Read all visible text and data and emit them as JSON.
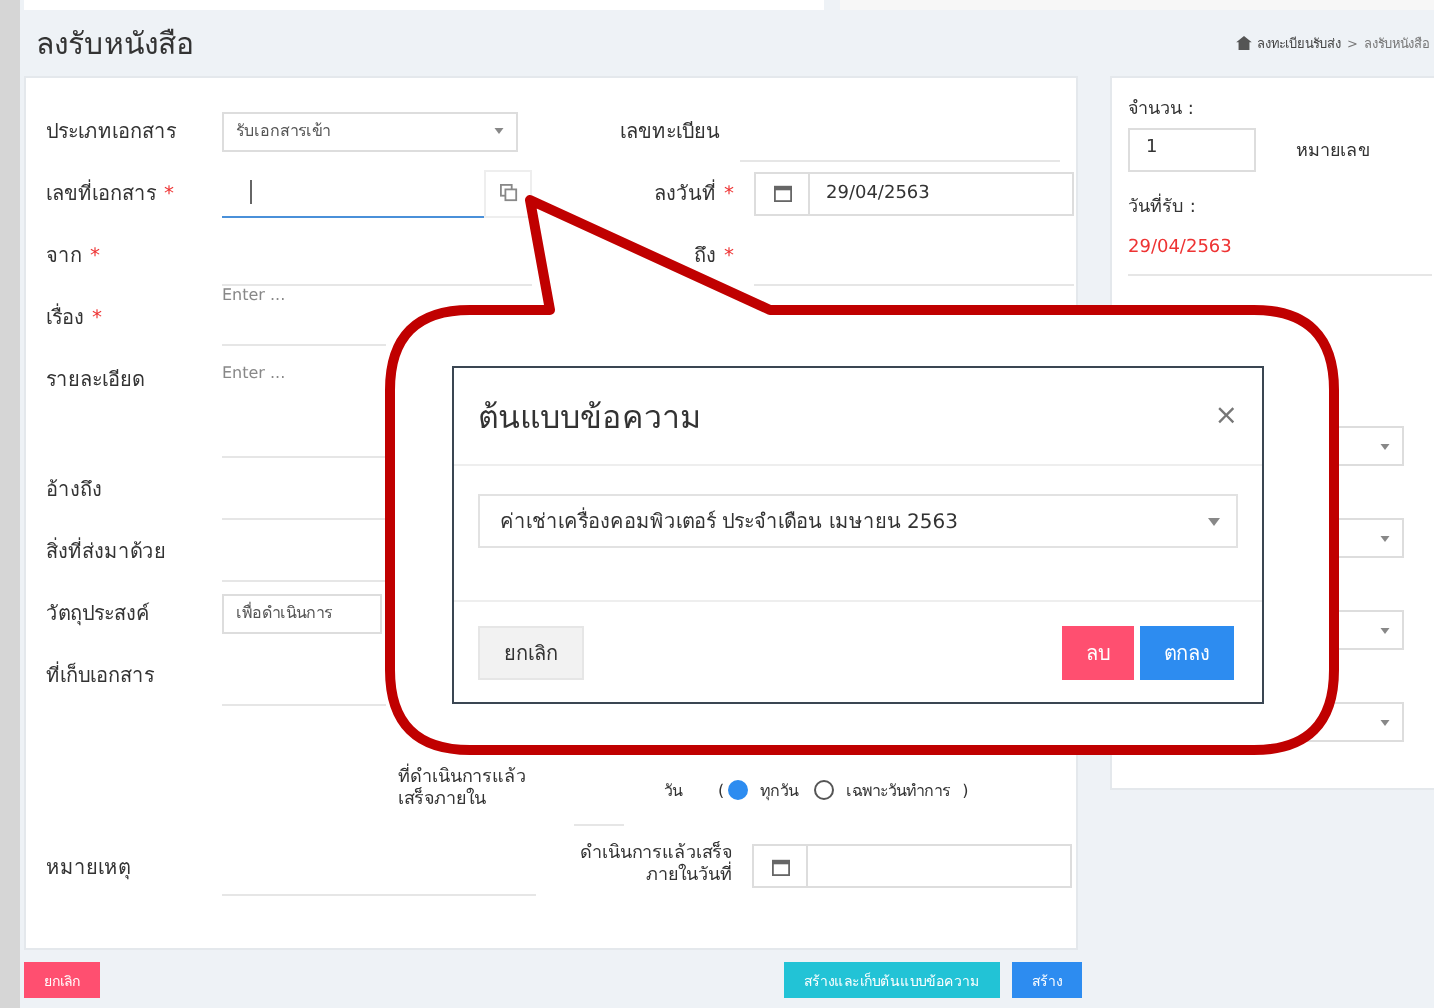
{
  "header": {
    "title": "ลงรับหนังสือ",
    "breadcrumb": [
      "ลงทะเบียนรับส่ง",
      "ลงรับหนังสือ"
    ],
    "separator": ">"
  },
  "form": {
    "top_rows": [
      {
        "left": {
          "label": "ประเภทเอกสาร",
          "kind": "select",
          "value": "รับเอกสารเข้า"
        },
        "right": {
          "label": "เลขทะเบียน",
          "kind": "line"
        }
      },
      {
        "left": {
          "label": "เลขที่เอกสาร",
          "mark": "*",
          "kind": "copy",
          "focused": true
        },
        "right": {
          "label": "ลงวันที่",
          "mark": "*",
          "kind": "date",
          "value": "29/04/2563"
        }
      },
      {
        "left": {
          "label": "จาก",
          "mark": "*",
          "kind": "line"
        },
        "right": {
          "label": "ถึง",
          "mark": "*",
          "kind": "line"
        }
      }
    ],
    "rows": [
      {
        "label": "เรื่อง",
        "mark": "*",
        "kind": "text",
        "placeholder": "Enter ..."
      },
      {
        "label": "รายละเอียด",
        "kind": "textarea",
        "placeholder": "Enter ..."
      },
      {
        "label": "อ้างถึง",
        "kind": "line"
      },
      {
        "label": "สิ่งที่ส่งมาด้วย",
        "kind": "line"
      },
      {
        "label": "วัตถุประสงค์",
        "kind": "select",
        "value": "เพื่อดำเนินการ"
      },
      {
        "label": "ที่เก็บเอกสาร",
        "kind": "line"
      }
    ],
    "deadline": {
      "label": "ที่ดำเนินการแล้วเสร็จภายใน",
      "unit": "วัน",
      "open": "(",
      "close": ")",
      "options": [
        {
          "label": "ทุกวัน",
          "selected": true
        },
        {
          "label": "เฉพาะวันทำการ",
          "selected": false
        }
      ]
    },
    "note": {
      "label": "หมายเหตุ"
    },
    "finish_date": {
      "label": "ดำเนินการแล้วเสร็จภายในวันที่"
    }
  },
  "side": {
    "count_label": "จำนวน :",
    "count_value": "1",
    "number_label": "หมายเลข",
    "received_label": "วันที่รับ :",
    "received_date": "29/04/2563",
    "selects": [
      {
        "kind": "select"
      },
      {
        "kind": "select"
      },
      {
        "kind": "select"
      },
      {
        "kind": "select"
      }
    ]
  },
  "footer": {
    "buttons": [
      {
        "label": "ยกเลิก",
        "kind": "danger"
      },
      {
        "label": "สร้างและเก็บต้นแบบข้อความ",
        "kind": "info"
      },
      {
        "label": "สร้าง",
        "kind": "primary"
      }
    ]
  },
  "modal": {
    "title": "ต้นแบบข้อความ",
    "close": "×",
    "select_value": "ค่าเช่าเครื่องคอมพิวเตอร์ ประจำเดือน เมษายน 2563",
    "buttons": [
      {
        "label": "ยกเลิก",
        "kind": "default"
      },
      {
        "label": "ลบ",
        "kind": "danger"
      },
      {
        "label": "ตกลง",
        "kind": "primary"
      }
    ]
  }
}
